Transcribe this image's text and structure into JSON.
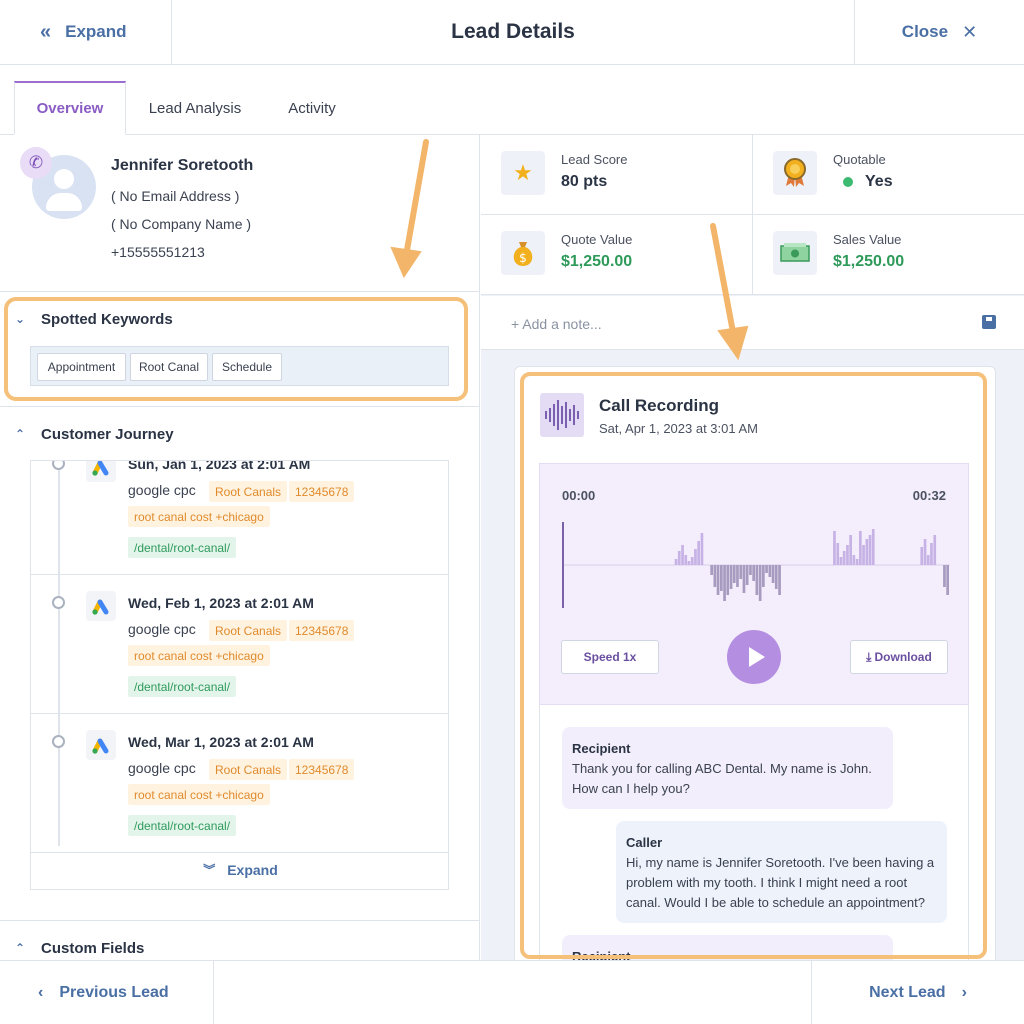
{
  "header": {
    "expand_label": "Expand",
    "title": "Lead Details",
    "close_label": "Close"
  },
  "tabs": [
    {
      "label": "Overview",
      "active": true
    },
    {
      "label": "Lead Analysis"
    },
    {
      "label": "Activity"
    }
  ],
  "contact": {
    "name": "Jennifer Soretooth",
    "email": "( No Email Address )",
    "company": "( No Company Name )",
    "phone": "+15555551213"
  },
  "keywords": {
    "title": "Spotted Keywords",
    "tags": [
      "Appointment",
      "Root Canal",
      "Schedule"
    ]
  },
  "journey": {
    "title": "Customer Journey",
    "items": [
      {
        "date": "Sun, Jan 1, 2023 at 2:01 AM",
        "source": "google cpc",
        "tag1": "Root Canals",
        "tag2": "12345678",
        "keyword": "root canal cost +chicago",
        "path": "/dental/root-canal/"
      },
      {
        "date": "Wed, Feb 1, 2023 at 2:01 AM",
        "source": "google cpc",
        "tag1": "Root Canals",
        "tag2": "12345678",
        "keyword": "root canal cost +chicago",
        "path": "/dental/root-canal/"
      },
      {
        "date": "Wed, Mar 1, 2023 at 2:01 AM",
        "source": "google cpc",
        "tag1": "Root Canals",
        "tag2": "12345678",
        "keyword": "root canal cost +chicago",
        "path": "/dental/root-canal/"
      }
    ],
    "expand_label": "Expand"
  },
  "custom_fields": {
    "title": "Custom Fields"
  },
  "stats": {
    "lead_score": {
      "label": "Lead Score",
      "value": "80 pts"
    },
    "quotable": {
      "label": "Quotable",
      "value": "Yes"
    },
    "quote_value": {
      "label": "Quote Value",
      "value": "$1,250.00"
    },
    "sales_value": {
      "label": "Sales Value",
      "value": "$1,250.00"
    }
  },
  "note": {
    "placeholder": "+ Add a note..."
  },
  "recording": {
    "title": "Call Recording",
    "date": "Sat, Apr 1, 2023 at 3:01 AM",
    "time_start": "00:00",
    "time_end": "00:32",
    "progress": 0,
    "speed_label": "Speed 1x",
    "download_label": "Download"
  },
  "transcript": [
    {
      "who": "Recipient",
      "text": "Thank you for calling ABC Dental. My name is John. How can I help you?"
    },
    {
      "who": "Caller",
      "text": "Hi, my name is Jennifer Soretooth. I've been having a problem with my tooth. I think I might need a root canal. Would I be able to schedule an appointment?"
    },
    {
      "who": "Recipient",
      "text": ""
    }
  ],
  "footer": {
    "prev_label": "Previous Lead",
    "next_label": "Next Lead"
  },
  "colors": {
    "accent": "#8a5cc4",
    "link": "#4a6fa5",
    "highlight": "#f5c07a",
    "money": "#2e9a5a"
  }
}
